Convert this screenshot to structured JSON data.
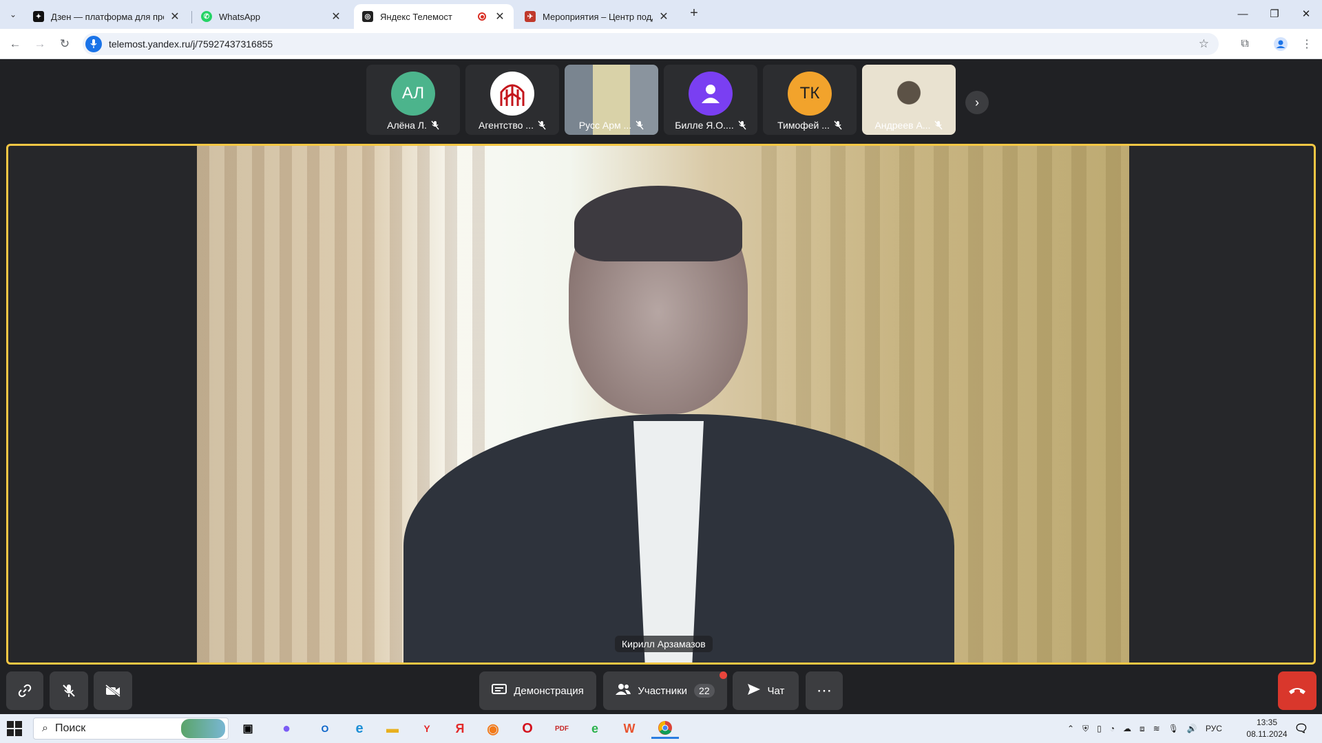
{
  "browser": {
    "tabs": [
      {
        "title": "Дзен — платформа для просм",
        "active": false
      },
      {
        "title": "WhatsApp",
        "active": false
      },
      {
        "title": "Яндекс Телемост",
        "active": true
      },
      {
        "title": "Мероприятия – Центр поддер",
        "active": false
      }
    ],
    "url": "telemost.yandex.ru/j/75927437316855"
  },
  "meeting": {
    "participants": [
      {
        "name": "Алёна Л.",
        "initials": "АЛ",
        "color": "#4cb48c",
        "type": "initials"
      },
      {
        "name": "Агентство ...",
        "initials": "",
        "color": "#ffffff",
        "type": "logo"
      },
      {
        "name": "Русс Арм ...",
        "initials": "",
        "color": "",
        "type": "video"
      },
      {
        "name": "Билле Я.О....",
        "initials": "",
        "color": "#7a3ff2",
        "type": "person"
      },
      {
        "name": "Тимофей ...",
        "initials": "ТК",
        "color": "#f2a32c",
        "type": "initials"
      },
      {
        "name": "Андреев А...",
        "initials": "",
        "color": "",
        "type": "video"
      }
    ],
    "speaker_name": "Кирилл Арзамазов",
    "controls": {
      "demo_label": "Демонстрация",
      "participants_label": "Участники",
      "participants_count": "22",
      "chat_label": "Чат"
    }
  },
  "taskbar": {
    "search_placeholder": "Поиск",
    "lang": "РУС",
    "time": "13:35",
    "date": "08.11.2024"
  },
  "colors": {
    "active_border": "#f6c744",
    "hangup": "#d9372c",
    "background": "#202124"
  }
}
